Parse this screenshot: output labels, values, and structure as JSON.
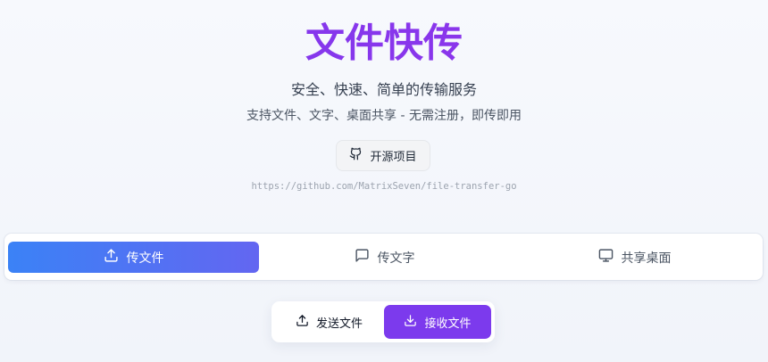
{
  "hero": {
    "title": "文件快传",
    "subtitle": "安全、快速、简单的传输服务",
    "description": "支持文件、文字、桌面共享 - 无需注册，即传即用"
  },
  "open_source": {
    "label": "开源项目",
    "icon": "github-icon",
    "url": "https://github.com/MatrixSeven/file-transfer-go"
  },
  "tabs": [
    {
      "label": "传文件",
      "icon": "upload-icon",
      "active": true
    },
    {
      "label": "传文字",
      "icon": "message-icon",
      "active": false
    },
    {
      "label": "共享桌面",
      "icon": "monitor-icon",
      "active": false
    }
  ],
  "mode": {
    "send_label": "发送文件",
    "receive_label": "接收文件",
    "selected": "receive"
  },
  "colors": {
    "title": "#8b2cf5",
    "active_tab_start": "#3b82f6",
    "active_tab_end": "#6366f1",
    "receive_button": "#7c3aed"
  }
}
